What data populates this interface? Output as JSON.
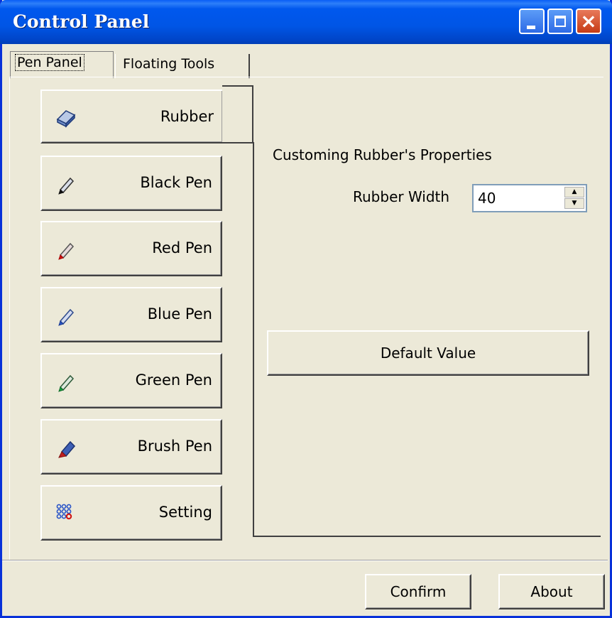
{
  "window": {
    "title": "Control Panel",
    "controls": [
      "minimize-icon",
      "maximize-icon",
      "close-icon"
    ],
    "titlebar_color": "#0055e5"
  },
  "tabs": [
    {
      "label": "Pen Panel",
      "selected": true
    },
    {
      "label": "Floating Tools",
      "selected": false
    }
  ],
  "sidebar": {
    "items": [
      {
        "label": "Rubber",
        "icon": "eraser-icon",
        "selected": true
      },
      {
        "label": "Black Pen",
        "icon": "pencil-icon"
      },
      {
        "label": "Red Pen",
        "icon": "pencil-icon"
      },
      {
        "label": "Blue Pen",
        "icon": "pencil-icon"
      },
      {
        "label": "Green Pen",
        "icon": "pencil-icon"
      },
      {
        "label": "Brush Pen",
        "icon": "marker-icon"
      },
      {
        "label": "Setting",
        "icon": "dots-grid-icon"
      }
    ]
  },
  "properties": {
    "section_title": "Customing Rubber's Properties",
    "rubber_width_label": "Rubber Width",
    "rubber_width_value": "40",
    "default_button": "Default Value"
  },
  "footer": {
    "confirm": "Confirm",
    "about": "About"
  }
}
